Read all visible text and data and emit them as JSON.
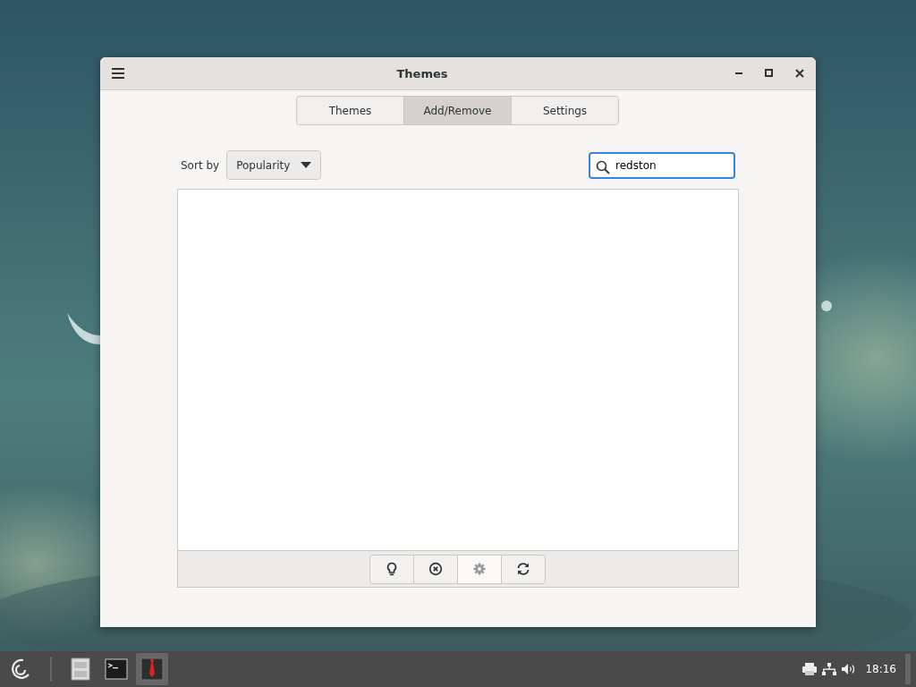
{
  "window": {
    "title": "Themes"
  },
  "tabs": [
    {
      "label": "Themes",
      "selected": false
    },
    {
      "label": "Add/Remove",
      "selected": true
    },
    {
      "label": "Settings",
      "selected": false
    }
  ],
  "sort": {
    "label": "Sort by",
    "value": "Popularity"
  },
  "search": {
    "value": "redston"
  },
  "toolbar": [
    {
      "kind": "bulb",
      "disabled": false
    },
    {
      "kind": "remove",
      "disabled": false
    },
    {
      "kind": "gear",
      "disabled": true
    },
    {
      "kind": "refresh",
      "disabled": false
    }
  ],
  "taskbar": {
    "apps": [
      {
        "kind": "files",
        "selected": false
      },
      {
        "kind": "terminal",
        "selected": false
      },
      {
        "kind": "themes",
        "selected": true
      }
    ],
    "clock": "18:16"
  }
}
